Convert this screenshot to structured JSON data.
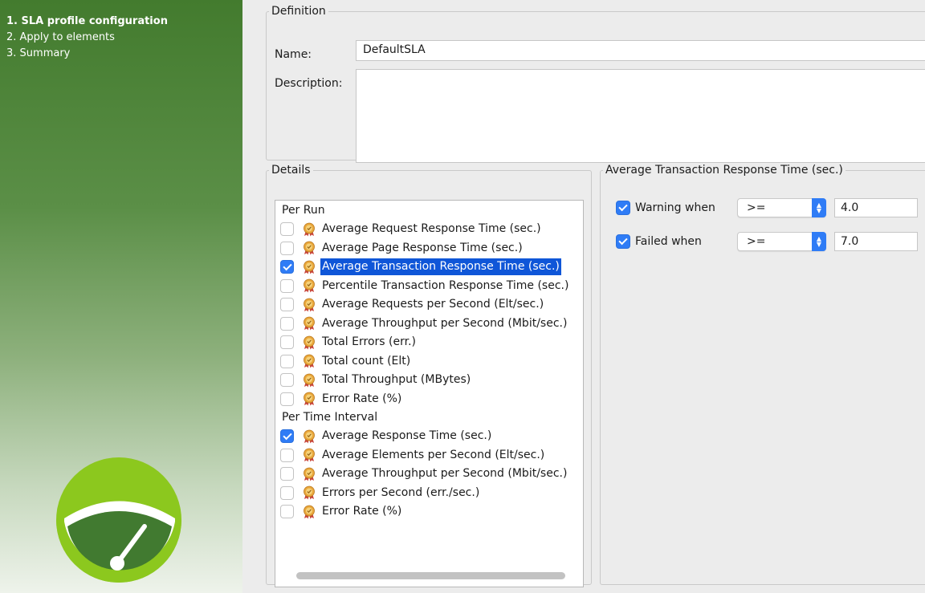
{
  "wizard": {
    "steps": [
      {
        "label": "1. SLA profile configuration",
        "active": true
      },
      {
        "label": "2. Apply to elements",
        "active": false
      },
      {
        "label": "3. Summary",
        "active": false
      }
    ]
  },
  "definition": {
    "title": "Definition",
    "name_label": "Name:",
    "name_value": "DefaultSLA",
    "description_label": "Description:",
    "description_value": ""
  },
  "details": {
    "title": "Details",
    "groups": [
      {
        "title": "Per Run",
        "items": [
          {
            "label": "Average Request Response Time (sec.)",
            "checked": false,
            "selected": false
          },
          {
            "label": "Average Page Response Time (sec.)",
            "checked": false,
            "selected": false
          },
          {
            "label": "Average Transaction Response Time (sec.)",
            "checked": true,
            "selected": true
          },
          {
            "label": "Percentile Transaction Response Time (sec.)",
            "checked": false,
            "selected": false
          },
          {
            "label": "Average Requests per Second (Elt/sec.)",
            "checked": false,
            "selected": false
          },
          {
            "label": "Average Throughput per Second (Mbit/sec.)",
            "checked": false,
            "selected": false
          },
          {
            "label": "Total Errors (err.)",
            "checked": false,
            "selected": false
          },
          {
            "label": "Total count (Elt)",
            "checked": false,
            "selected": false
          },
          {
            "label": "Total Throughput (MBytes)",
            "checked": false,
            "selected": false
          },
          {
            "label": "Error Rate (%)",
            "checked": false,
            "selected": false
          }
        ]
      },
      {
        "title": "Per Time Interval",
        "items": [
          {
            "label": "Average Response Time (sec.)",
            "checked": true,
            "selected": false
          },
          {
            "label": "Average Elements per Second (Elt/sec.)",
            "checked": false,
            "selected": false
          },
          {
            "label": "Average Throughput per Second (Mbit/sec.)",
            "checked": false,
            "selected": false
          },
          {
            "label": "Errors per Second (err./sec.)",
            "checked": false,
            "selected": false
          },
          {
            "label": "Error Rate (%)",
            "checked": false,
            "selected": false
          }
        ]
      }
    ]
  },
  "thresholds": {
    "title": "Average Transaction Response Time (sec.)",
    "warning": {
      "label": "Warning when",
      "checked": true,
      "operator": ">=",
      "value": "4.0"
    },
    "failed": {
      "label": "Failed when",
      "checked": true,
      "operator": ">=",
      "value": "7.0"
    }
  },
  "colors": {
    "accent": "#2f7cf6",
    "selection": "#0f56d8",
    "wizard_green": "#437b2e",
    "logo_lime": "#8cc81e"
  },
  "icons": {
    "sla_item": "sla-medal-icon",
    "logo": "speedometer-logo"
  }
}
